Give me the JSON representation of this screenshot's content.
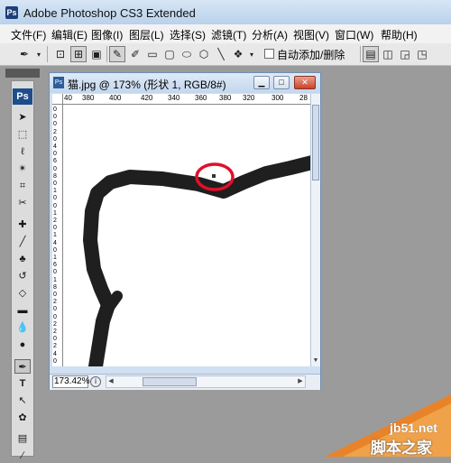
{
  "app": {
    "title": "Adobe Photoshop CS3 Extended",
    "logo_text": "Ps"
  },
  "menu": [
    "文件(F)",
    "编辑(E)",
    "图像(I)",
    "图层(L)",
    "选择(S)",
    "滤镜(T)",
    "分析(A)",
    "视图(V)",
    "窗口(W)",
    "帮助(H)"
  ],
  "options_bar": {
    "auto_add_delete_label": "自动添加/删除",
    "auto_add_delete_checked": false
  },
  "tools_panel": {
    "logo": "Ps",
    "tools": [
      "move-tool",
      "marquee-tool",
      "lasso-tool",
      "magic-wand-tool",
      "crop-tool",
      "slice-tool",
      "healing-brush-tool",
      "brush-tool",
      "clone-stamp-tool",
      "history-brush-tool",
      "eraser-tool",
      "gradient-tool",
      "blur-tool",
      "dodge-tool",
      "pen-tool",
      "type-tool",
      "path-selection-tool",
      "custom-shape-tool",
      "notes-tool",
      "eyedropper-tool"
    ],
    "active_tool": "pen-tool"
  },
  "document": {
    "title": "猫.jpg @ 173% (形状 1, RGB/8#)",
    "zoom": "173.42%",
    "ruler_h": [
      "40",
      "380",
      "400",
      "420",
      "340",
      "360",
      "380",
      "320",
      "300",
      "28"
    ],
    "ruler_v": [
      "0",
      "0",
      "0",
      "2",
      "0",
      "4",
      "0",
      "6",
      "0",
      "8",
      "0",
      "1",
      "0",
      "0",
      "1",
      "2",
      "0",
      "1",
      "4",
      "0",
      "1",
      "6",
      "0",
      "1",
      "8",
      "0",
      "2",
      "0",
      "0",
      "2",
      "2",
      "0",
      "2",
      "4",
      "0"
    ]
  },
  "watermark": {
    "site": "jb51.net",
    "name": "脚本之家"
  }
}
